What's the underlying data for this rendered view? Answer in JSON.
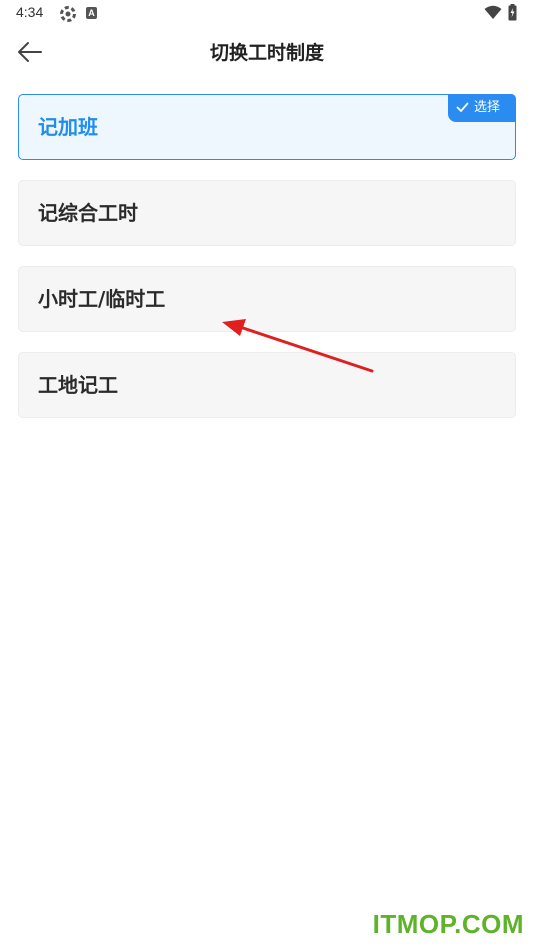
{
  "status_bar": {
    "time": "4:34",
    "icons": [
      "gear-icon",
      "a-badge-icon",
      "wifi-icon",
      "battery-icon"
    ]
  },
  "header": {
    "back_icon": "arrow-left-icon",
    "title": "切换工时制度"
  },
  "options": [
    {
      "label": "记加班",
      "selected": true
    },
    {
      "label": "记综合工时",
      "selected": false
    },
    {
      "label": "小时工/临时工",
      "selected": false
    },
    {
      "label": "工地记工",
      "selected": false
    }
  ],
  "select_badge": {
    "label": "选择",
    "icon": "check-icon"
  },
  "colors": {
    "accent": "#2a8cf0",
    "selected_bg": "#eef6fe",
    "option_bg": "#f6f6f6",
    "arrow": "#e02020",
    "watermark": "#5fb32a"
  },
  "watermark": "ITMOP.COM"
}
